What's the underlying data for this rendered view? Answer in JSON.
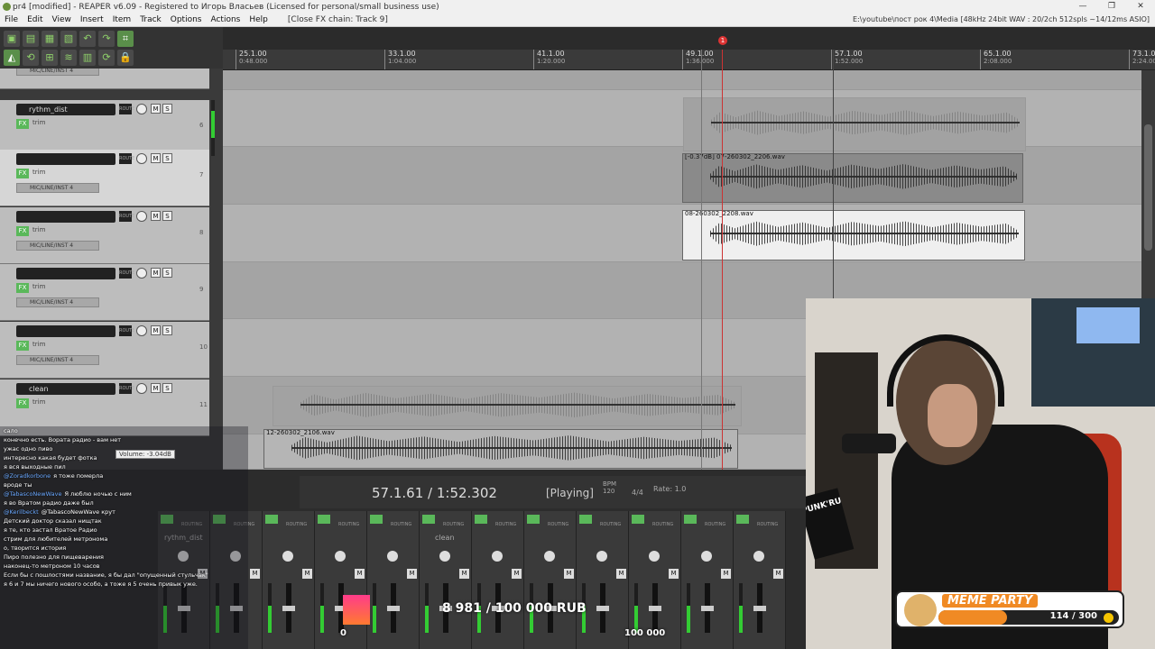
{
  "window": {
    "title": "pr4 [modified] - REAPER v6.09 - Registered to Игорь Власьев (Licensed for personal/small business use)",
    "controls": [
      "—",
      "❐",
      "✕"
    ]
  },
  "menu": {
    "items": [
      "File",
      "Edit",
      "View",
      "Insert",
      "Item",
      "Track",
      "Options",
      "Actions",
      "Help"
    ],
    "fx_chain": "[Close FX chain: Track 9]",
    "status": "E:\\youtube\\пост рок 4\\Media [48kHz 24bit WAV : 20/2ch 512spls ~14/12ms ASIO]"
  },
  "ruler": {
    "marks": [
      {
        "bar": "25.1.00",
        "time": "0:48.000"
      },
      {
        "bar": "33.1.00",
        "time": "1:04.000"
      },
      {
        "bar": "41.1.00",
        "time": "1:20.000"
      },
      {
        "bar": "49.1.00",
        "time": "1:36.000"
      },
      {
        "bar": "57.1.00",
        "time": "1:52.000"
      },
      {
        "bar": "65.1.00",
        "time": "2:08.000"
      },
      {
        "bar": "73.1.00",
        "time": "2:24.000"
      }
    ],
    "marker_label": "1"
  },
  "tracks": [
    {
      "name": "",
      "num": "",
      "input": "MIC/LINE/INST 4",
      "armed": false,
      "sel": false
    },
    {
      "name": "rythm_dist",
      "num": "6",
      "input": "",
      "armed": false,
      "sel": false
    },
    {
      "name": "",
      "num": "7",
      "input": "MIC/LINE/INST 4",
      "armed": false,
      "sel": true
    },
    {
      "name": "",
      "num": "8",
      "input": "MIC/LINE/INST 4",
      "armed": false,
      "sel": false
    },
    {
      "name": "",
      "num": "9",
      "input": "MIC/LINE/INST 4",
      "armed": true,
      "sel": false
    },
    {
      "name": "",
      "num": "10",
      "input": "MIC/LINE/INST 4",
      "armed": false,
      "sel": false
    },
    {
      "name": "clean",
      "num": "11",
      "input": "",
      "armed": false,
      "sel": false
    }
  ],
  "items": {
    "item7": "[-0.37dB] 07-260302_2206.wav",
    "item8": "08-260302_2208.wav",
    "item12": "12-260302_2106.wav"
  },
  "track_labels": {
    "fx": "FX",
    "trim": "trim",
    "in": "IN",
    "route": "ROUTE",
    "mute": "M",
    "solo": "S"
  },
  "tooltip": "Volume: -3.04dB",
  "transport": {
    "time": "57.1.61 / 1:52.302",
    "state": "[Playing]",
    "bpm_label": "BPM",
    "bpm": "120",
    "signature": "4/4",
    "rate_label": "Rate:",
    "rate": "1.0"
  },
  "mixer": {
    "channel_count": 12,
    "labels": {
      "rythm": "rythm_dist",
      "clean": "clean"
    },
    "routing": "ROUTING",
    "mute": "M",
    "solo": "S"
  },
  "chat": [
    {
      "user": "",
      "text": "сало"
    },
    {
      "user": "",
      "text": "конечно есть. Вората радио - вам нет"
    },
    {
      "user": "",
      "text": "ужас одно пиво"
    },
    {
      "user": "",
      "text": "интересно какая будет фотка"
    },
    {
      "user": "",
      "text": "я вся выходные пил"
    },
    {
      "user": "@Zoradkorbone",
      "text": "я тоже померла"
    },
    {
      "user": "",
      "text": "вроде ты"
    },
    {
      "user": "@TabascoNewWave",
      "text": "Я люблю ночью с ним"
    },
    {
      "user": "",
      "text": "я во Вратом радио даже был"
    },
    {
      "user": "@Kerilbeckt",
      "text": "@TabascoNewWave крут"
    },
    {
      "user": "",
      "text": "Детский доктор сказал нищтак"
    },
    {
      "user": "",
      "text": "я те, кто застал Вратое Радио"
    },
    {
      "user": "",
      "text": "стрим для любителей метронома"
    },
    {
      "user": "",
      "text": "о, творится история"
    },
    {
      "user": "",
      "text": "Пиро полезно для пищеварения"
    },
    {
      "user": "",
      "text": "наконец-то метроном 10 часов"
    },
    {
      "user": "",
      "text": "Если бы с пошлостями название, я бы дал \"опущенный стульчак\""
    },
    {
      "user": "",
      "text": "я 6 и 7 мы ничего нового особо, а тоже я 5 очень привык уже."
    }
  ],
  "donation": {
    "amount": "8 981 / 100 000 RUB",
    "min": "0",
    "max": "100 000",
    "progress": 0.0898
  },
  "meme_party": {
    "title": "MEME PARTY",
    "count": "114 / 300",
    "progress": 0.38
  },
  "webcam": {
    "sticker": "PUNK'RU"
  }
}
